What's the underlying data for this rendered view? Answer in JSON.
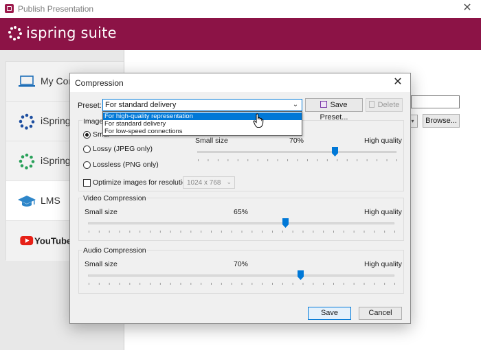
{
  "window": {
    "title": "Publish Presentation",
    "close_glyph": "✕"
  },
  "brand": {
    "name": "ispring suite",
    "color": "#8c1346"
  },
  "sidebar": {
    "items": [
      {
        "label": "My Com",
        "icon": "laptop-icon"
      },
      {
        "label": "iSpring",
        "icon": "ispring-cloud-icon"
      },
      {
        "label": "iSpring",
        "icon": "ispring-learn-icon"
      },
      {
        "label": "LMS",
        "icon": "graduation-cap-icon"
      },
      {
        "label": "YouTube",
        "icon": "youtube-logo"
      }
    ],
    "active_index": 3
  },
  "background": {
    "browse_label": "Browse..."
  },
  "dialog": {
    "title": "Compression",
    "close_glyph": "✕",
    "preset": {
      "label": "Preset:",
      "value": "For standard delivery",
      "options": [
        "For high-quality representation",
        "For standard delivery",
        "For low-speed connections"
      ],
      "highlighted_option_index": 0
    },
    "save_preset_label": "Save Preset...",
    "delete_label": "Delete",
    "image": {
      "group_label": "Image",
      "options": [
        "Smart (PNG + JPEG)",
        "Lossy (JPEG only)",
        "Lossless (PNG only)"
      ],
      "visible_option_labels": [
        "Smar",
        "Lossy (JPEG only)",
        "Lossless (PNG only)"
      ],
      "selected_index": 0,
      "optimize_label": "Optimize images for resolution:",
      "optimize_checked": false,
      "resolution_value": "1024 x 768",
      "small_label": "Small size",
      "high_label": "High quality",
      "quality_label": "70%",
      "quality": 70
    },
    "video": {
      "group_label": "Video Compression",
      "small_label": "Small size",
      "high_label": "High quality",
      "quality_label": "65%",
      "quality": 65
    },
    "audio": {
      "group_label": "Audio Compression",
      "small_label": "Small size",
      "high_label": "High quality",
      "quality_label": "70%",
      "quality": 70
    },
    "save_label": "Save",
    "cancel_label": "Cancel"
  },
  "accent_color": "#0078d7"
}
